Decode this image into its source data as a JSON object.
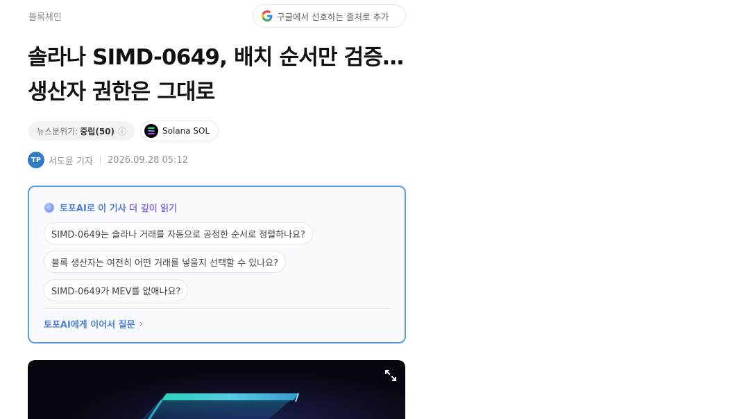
{
  "article": {
    "category": "블록체인",
    "google_pref_label": "구글에서 선호하는 출처로 추가",
    "headline_line1": "솔라나 SIMD-0649, 배치 순서만 검증…",
    "headline_line2": "생산자 권한은 그대로",
    "mood_label": "뉴스분위기:",
    "mood_value": "중립(50)",
    "coin_label": "Solana SOL",
    "author": "서도윤 기자",
    "timestamp": "2026.09.28 05:12",
    "avatar_text": "TP"
  },
  "ai_box": {
    "title_blue": "토포AI로 이 기사 ",
    "title_purple": "더 깊이 읽기",
    "questions": [
      "SIMD-0649는 솔라나 거래를 자동으로 공정한 순서로 정렬하나요?",
      "블록 생산자는 여전히 어떤 거래를 넣을지 선택할 수 있나요?",
      "SIMD-0649가 MEV를 없애나요?"
    ],
    "continue_label": "토포AI에게 이어서 질문"
  },
  "colors": {
    "accent_blue": "#5b9ae6",
    "ai_text_blue": "#4f7fd9",
    "ai_text_purple": "#8a6fe0"
  },
  "icons": [
    "google-g-icon",
    "info-icon",
    "solana-logo-icon",
    "ai-orb-icon",
    "chevron-right-icon",
    "expand-icon"
  ]
}
